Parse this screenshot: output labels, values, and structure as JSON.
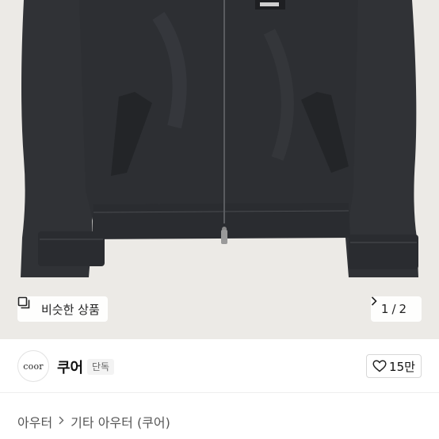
{
  "image_gallery": {
    "similar_label": "비슷한 상품",
    "similar_icon": "similar-items-icon",
    "current_page": "1",
    "page_separator": "/",
    "total_pages": "2",
    "next_icon": "chevron-right-icon"
  },
  "seller": {
    "logo_text": "coor",
    "name": "쿠어",
    "badge": "단독"
  },
  "like": {
    "icon": "heart-icon",
    "count": "15만"
  },
  "breadcrumb": {
    "category": "아우터",
    "separator_icon": "chevron-right-icon",
    "subcategory": "기타 아우터 (쿠어)"
  },
  "colors": {
    "image_background": "#eceae6",
    "jacket": "#2b2d31",
    "chip_background": "#ffffff"
  }
}
